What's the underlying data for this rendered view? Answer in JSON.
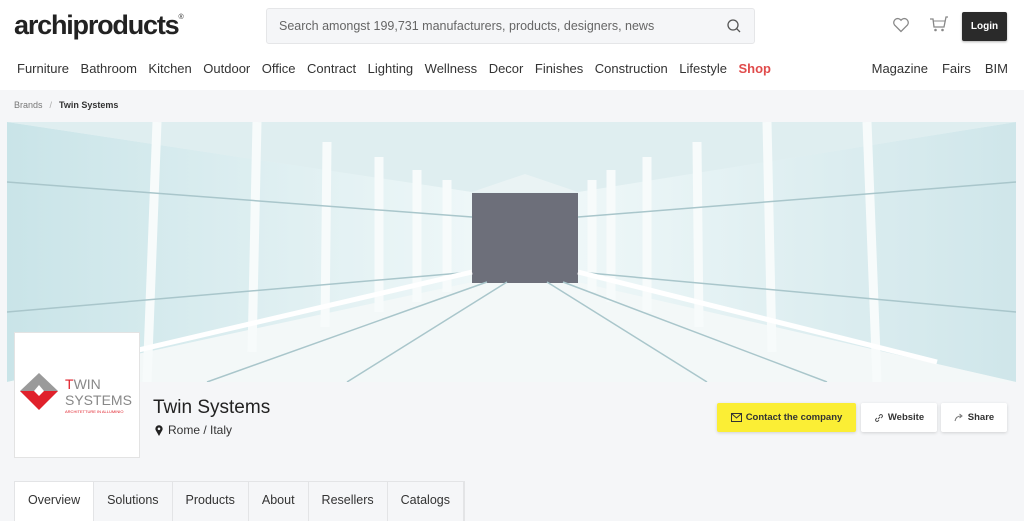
{
  "header": {
    "logo": "archiproducts",
    "search_placeholder": "Search amongst 199,731 manufacturers, products, designers, news",
    "login_label": "Login"
  },
  "nav": {
    "items": [
      "Furniture",
      "Bathroom",
      "Kitchen",
      "Outdoor",
      "Office",
      "Contract",
      "Lighting",
      "Wellness",
      "Decor",
      "Finishes",
      "Construction",
      "Lifestyle"
    ],
    "shop": "Shop",
    "right": [
      "Magazine",
      "Fairs",
      "BIM"
    ]
  },
  "breadcrumb": {
    "parent": "Brands",
    "current": "Twin Systems"
  },
  "company": {
    "name": "Twin Systems",
    "location": "Rome / Italy",
    "logo_text": "TWIN SYSTEMS ARCHITETTURE IN ALLUMINIO"
  },
  "actions": {
    "contact": "Contact the company",
    "website": "Website",
    "share": "Share"
  },
  "tabs": [
    "Overview",
    "Solutions",
    "Products",
    "About",
    "Resellers",
    "Catalogs"
  ],
  "colors": {
    "accent_yellow": "#fbee35",
    "shop_red": "#e04b4b",
    "logo_red": "#e0212b"
  }
}
